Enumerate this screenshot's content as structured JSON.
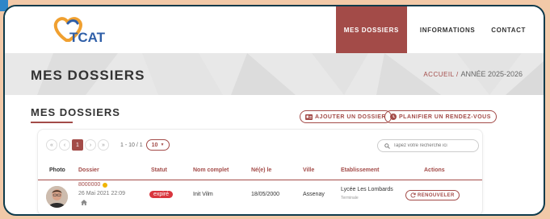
{
  "brand": {
    "logo_text": "TCAT"
  },
  "nav": {
    "items": [
      {
        "label": "MES DOSSIERS"
      },
      {
        "label": "INFORMATIONS"
      },
      {
        "label": "CONTACT"
      }
    ]
  },
  "page": {
    "title": "MES DOSSIERS"
  },
  "breadcrumb": {
    "home": "ACCUEIL",
    "separator": "/",
    "current": "ANNÉE 2025-2026"
  },
  "section": {
    "title": "MES DOSSIERS"
  },
  "actions": {
    "add_label": "AJOUTER UN DOSSIER",
    "plan_label": "PLANIFIER UN RENDEZ-VOUS"
  },
  "pager": {
    "first": "«",
    "prev": "‹",
    "current": "1",
    "next": "›",
    "last": "»",
    "info": "1 - 10 / 1",
    "page_size": "10"
  },
  "search": {
    "placeholder": "Tapez votre recherche ici"
  },
  "table": {
    "columns": [
      "Photo",
      "Dossier",
      "Statut",
      "Nom complet",
      "Né(e) le",
      "Ville",
      "Etablissement",
      "Actions"
    ],
    "rows": [
      {
        "dossier_id": "8000000",
        "dossier_date": "26 Mai 2021 22:09",
        "status": "expiré",
        "name": "Init Vilm",
        "birth": "18/05/2000",
        "city": "Assenay",
        "school": "Lycée Les Lombards",
        "school_level": "Terminale",
        "action": "RENOUVELER"
      }
    ]
  },
  "colors": {
    "accent": "#a34b48",
    "frame": "#0d3b4c",
    "status_expired": "#d9363e",
    "pending_dot": "#f0b400",
    "logo_orange": "#f0a030",
    "logo_blue": "#2f5fa8"
  }
}
